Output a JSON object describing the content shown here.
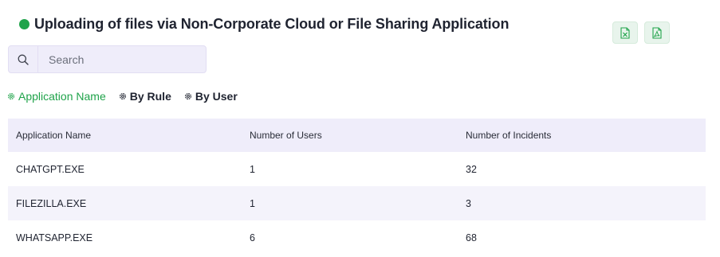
{
  "header": {
    "title": "Uploading of files via Non-Corporate Cloud or File Sharing Application",
    "status_color": "#1fa34a",
    "export_excel_icon": "excel-file-icon",
    "export_pdf_icon": "pdf-file-icon"
  },
  "search": {
    "placeholder": "Search",
    "value": ""
  },
  "tabs": [
    {
      "label": "Application Name",
      "active": true,
      "icon": "gear-icon"
    },
    {
      "label": "By Rule",
      "active": false,
      "icon": "gear-icon"
    },
    {
      "label": "By User",
      "active": false,
      "icon": "gear-icon"
    }
  ],
  "table": {
    "columns": [
      "Application Name",
      "Number of Users",
      "Number of Incidents"
    ],
    "rows": [
      [
        "CHATGPT.EXE",
        "1",
        "32"
      ],
      [
        "FILEZILLA.EXE",
        "1",
        "3"
      ],
      [
        "WHATSAPP.EXE",
        "6",
        "68"
      ]
    ]
  },
  "colors": {
    "accent": "#1fa34a",
    "header_bg": "#efedfa"
  }
}
